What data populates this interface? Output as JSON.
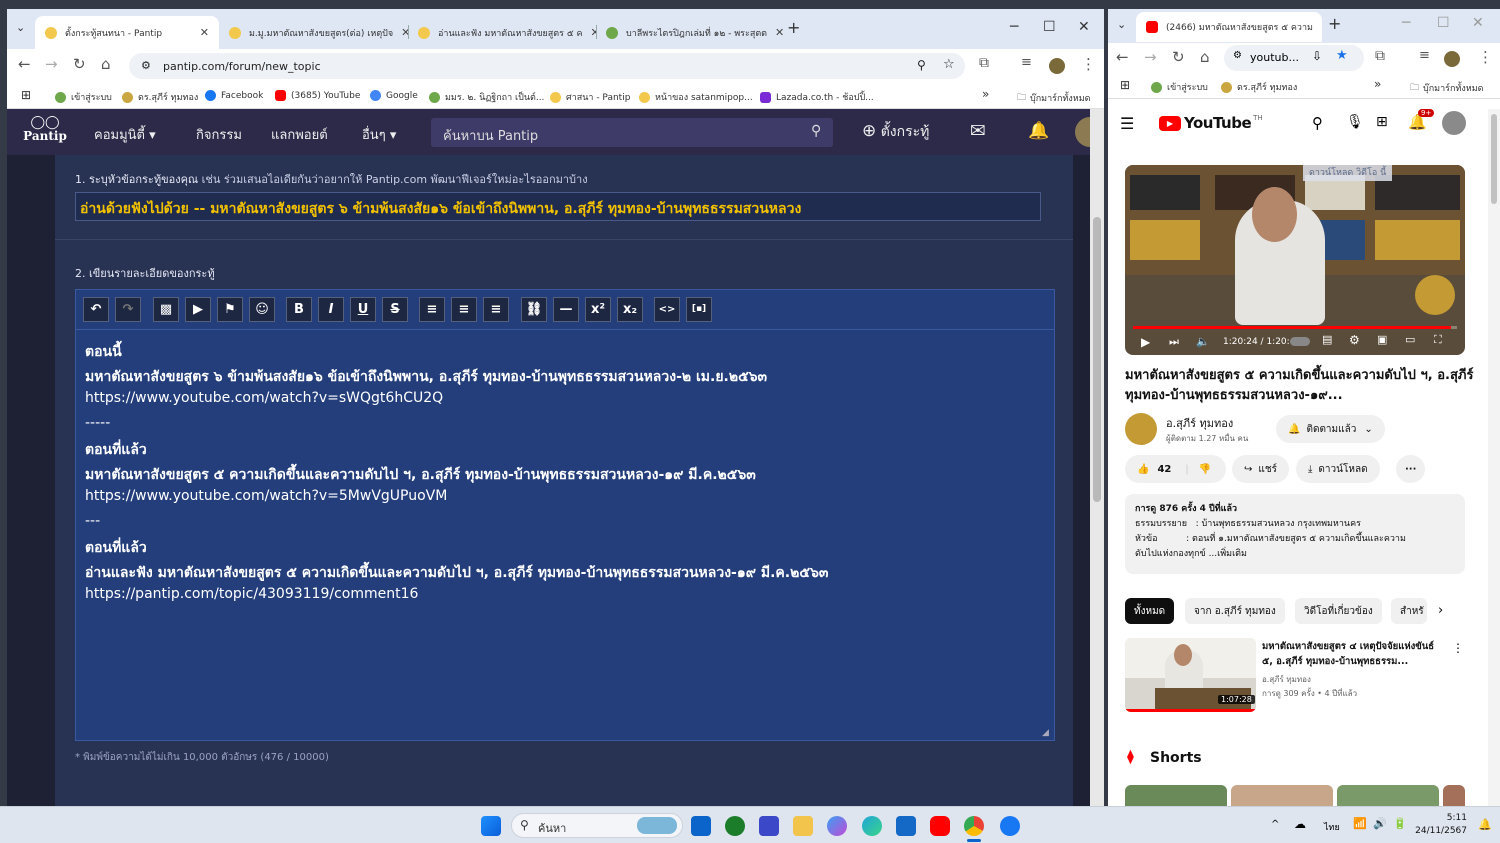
{
  "left_browser": {
    "tabs": [
      {
        "label": "ตั้งกระทู้สนทนา - Pantip",
        "color": "#f2c94c"
      },
      {
        "label": "ม.มู.มหาตัณหาสังขยสูตร(ต่อ) เหตุปัจ",
        "color": "#f2c94c"
      },
      {
        "label": "อ่านและฟัง มหาตัณหาสังขยสูตร ๕ ค",
        "color": "#f2c94c"
      },
      {
        "label": "บาลีพระไตรปิฎกเล่มที่ ๑๒ - พระสุตต",
        "color": "#6fa74b"
      }
    ],
    "new_tab": "+",
    "minimize": "─",
    "maximize": "☐",
    "close": "✕",
    "url": "pantip.com/forum/new_topic",
    "bookmarks": [
      {
        "label": "เข้าสู่ระบบ",
        "color": "#6fa74b"
      },
      {
        "label": "ดร.สุภีร์ ทุมทอง",
        "color": "#c9a640"
      },
      {
        "label": "Facebook",
        "color": "#1877f2"
      },
      {
        "label": "(3685) YouTube",
        "color": "#ff0000"
      },
      {
        "label": "Google",
        "color": "#4285f4"
      },
      {
        "label": "มมร. ๒. นิฏฐิกถา เป็นต์...",
        "color": "#6fa74b"
      },
      {
        "label": "ศาสนา - Pantip",
        "color": "#f2c94c"
      },
      {
        "label": "หน้าของ satanmipop...",
        "color": "#f2c94c"
      },
      {
        "label": "Lazada.co.th - ช้อปปิ้...",
        "color": "#7a2bd6"
      }
    ],
    "bm_more": "»",
    "bm_folder": "บุ๊กมาร์กทั้งหมด"
  },
  "pantip": {
    "logo": "Pantip",
    "nav": [
      "คอมมูนิตี้",
      "กิจกรรม",
      "แลกพอยต์",
      "อื่นๆ"
    ],
    "search_placeholder": "ค้นหาบน Pantip",
    "new_topic": "ตั้งกระทู้",
    "step1_label": "1. ระบุหัวข้อกระทู้ของคุณ",
    "step1_hint": "เช่น ร่วมเสนอไอเดียกันว่าอยากให้ Pantip.com พัฒนาฟีเจอร์ใหม่อะไรออกมาบ้าง",
    "title_value": "อ่านด้วยฟังไปด้วย -- มหาตัณหาสังขยสูตร ๖ ข้ามพ้นสงสัย๑๖ ข้อเข้าถึงนิพพาน, อ.สุภีร์ ทุมทอง-บ้านพุทธธรรมสวนหลวง",
    "step2_label": "2. เขียนรายละเอียดของกระทู้",
    "editor_lines": [
      "ตอนนี้",
      "มหาตัณหาสังขยสูตร ๖ ข้ามพ้นสงสัย๑๖ ข้อเข้าถึงนิพพาน, อ.สุภีร์ ทุมทอง-บ้านพุทธธรรมสวนหลวง-๒ เม.ย.๒๕๖๓",
      "https://www.youtube.com/watch?v=sWQgt6hCU2Q",
      "-----",
      "ตอนที่แล้ว",
      "มหาตัณหาสังขยสูตร ๕ ความเกิดขึ้นและความดับไป ฯ, อ.สุภีร์ ทุมทอง-บ้านพุทธธรรมสวนหลวง-๑๙ มี.ค.๒๕๖๓",
      "https://www.youtube.com/watch?v=5MwVgUPuoVM",
      "---",
      "ตอนที่แล้ว",
      "อ่านและฟัง มหาตัณหาสังขยสูตร ๕ ความเกิดขึ้นและความดับไป ฯ, อ.สุภีร์ ทุมทอง-บ้านพุทธธรรมสวนหลวง-๑๙ มี.ค.๒๕๖๓",
      "https://pantip.com/topic/43093119/comment16"
    ],
    "char_count": "* พิมพ์ข้อความได้ไม่เกิน 10,000 ตัวอักษร (476 / 10000)"
  },
  "right_browser": {
    "tab_label": "(2466) มหาตัณหาสังขยสูตร ๕ ความ",
    "url": "youtub...",
    "bookmarks": [
      "เข้าสู่ระบบ",
      "ดร.สุภีร์ ทุมทอง"
    ],
    "bm_folder": "บุ๊กมาร์กทั้งหมด",
    "yt_logo": "YouTube",
    "yt_region": "TH",
    "notif_count": "9+",
    "download_overlay": "ดาวน์โหลด วิดีโอ นี้",
    "video_time": "1:20:24 / 1:20:",
    "video_progress": 0.98,
    "title": "มหาตัณหาสังขยสูตร ๕ ความเกิดขึ้นและความดับไป ฯ, อ.สุภีร์ ทุมทอง-บ้านพุทธธรรมสวนหลวง-๑๙...",
    "channel": "อ.สุภีร์ ทุมทอง",
    "subs": "ผู้ติดตาม 1.27 หมื่น คน",
    "subscribed": "ติดตามแล้ว",
    "likes": "42",
    "share": "แชร์",
    "download": "ดาวน์โหลด",
    "more": "···",
    "desc_meta": "การดู 876 ครั้ง  4 ปีที่แล้ว",
    "desc_line1": "ธรรมบรรยาย   : บ้านพุทธธรรมสวนหลวง กรุงเทพมหานคร",
    "desc_line2": "หัวข้อ          : ตอนที่ ๑.มหาตัณหาสังขยสูตร ๕ ความเกิดขึ้นและความ",
    "desc_line3": "ดับไปแห่งกองทุกข์ ...เพิ่มเติม",
    "chips": [
      "ทั้งหมด",
      "จาก อ.สุภีร์ ทุมทอง",
      "วิดีโอที่เกี่ยวข้อง",
      "สำหรั"
    ],
    "related_title": "มหาตัณหาสังขยสูตร ๔ เหตุปัจจัยแห่งขันธ์ ๕, อ.สุภีร์ ทุมทอง-บ้านพุทธธรรม...",
    "related_channel": "อ.สุภีร์ ทุมทอง",
    "related_meta": "การดู 309 ครั้ง  • 4 ปีที่แล้ว",
    "related_duration": "1:07:28",
    "shorts_label": "Shorts"
  },
  "taskbar": {
    "search": "ค้นหา",
    "lang": "ไทย",
    "time": "5:11",
    "date": "24/11/2567",
    "caret": "^"
  }
}
